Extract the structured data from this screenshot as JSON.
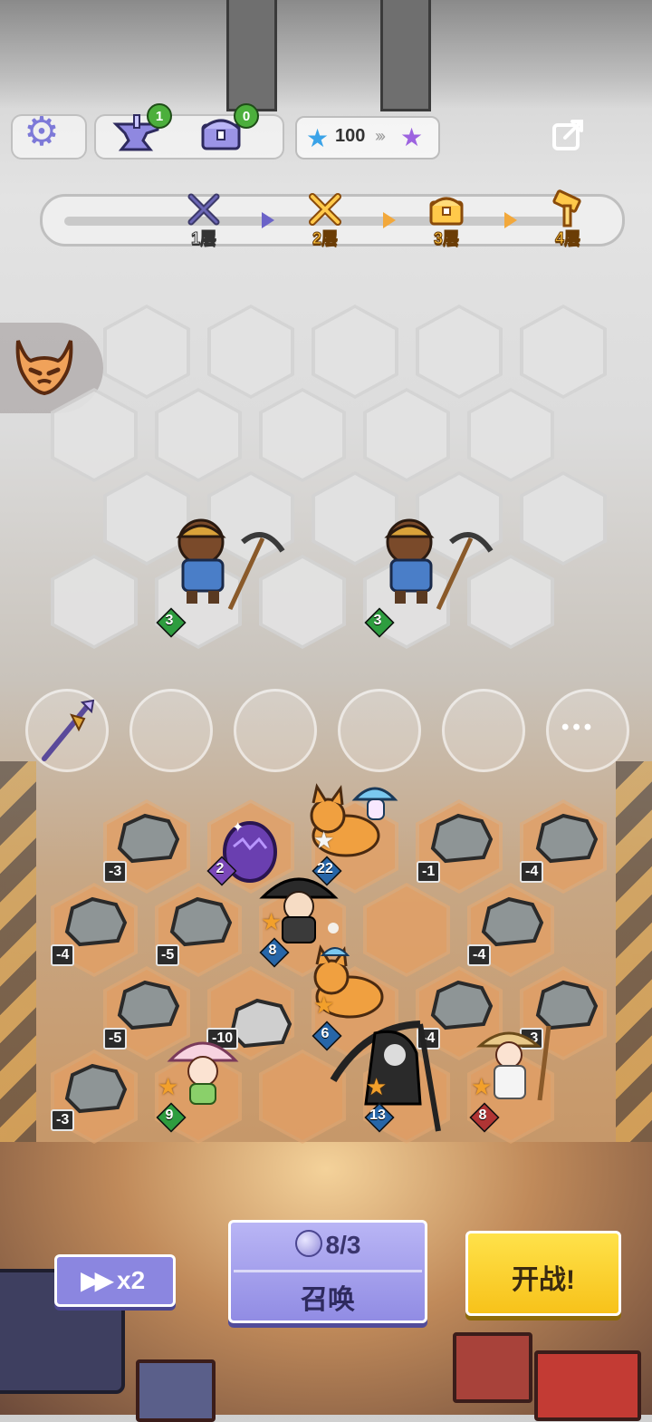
{
  "topbar": {
    "settings_icon": "gear-icon",
    "anvil_count": "1",
    "chest_count": "0",
    "star_count": "100",
    "share_icon": "share-icon"
  },
  "floors": [
    {
      "label": "1层",
      "icon": "crossed-swords-icon",
      "state": "cleared"
    },
    {
      "label": "2层",
      "icon": "crossed-swords-icon",
      "state": "current"
    },
    {
      "label": "3层",
      "icon": "treasure-chest-icon",
      "state": "upcoming"
    },
    {
      "label": "4层",
      "icon": "hammer-icon",
      "state": "upcoming"
    }
  ],
  "enemies": [
    {
      "name": "miner-bear",
      "level": "3"
    },
    {
      "name": "miner-bear",
      "level": "3"
    }
  ],
  "bench": {
    "item": "spear-icon",
    "more_label": "•••"
  },
  "board": {
    "rocks": [
      "-3",
      "-1",
      "-4",
      "-4",
      "-5",
      "-4",
      "-5",
      "-10",
      "-4",
      "-3",
      "-3"
    ],
    "units": [
      {
        "name": "purple-egg",
        "level": "2"
      },
      {
        "name": "corgi-mushroom",
        "level": "22"
      },
      {
        "name": "witch-girl",
        "level": "8"
      },
      {
        "name": "corgi",
        "level": "6"
      },
      {
        "name": "mushroom-fairy",
        "level": "9"
      },
      {
        "name": "reaper",
        "level": "13"
      },
      {
        "name": "straw-hat-monk",
        "level": "8"
      }
    ]
  },
  "controls": {
    "speed_label": "x2",
    "summon_cost": "8/3",
    "summon_label": "召唤",
    "battle_label": "开战!"
  },
  "colors": {
    "accent_purple": "#918ce4",
    "battle_yellow": "#f7c21a",
    "badge_green": "#4caf3c"
  }
}
